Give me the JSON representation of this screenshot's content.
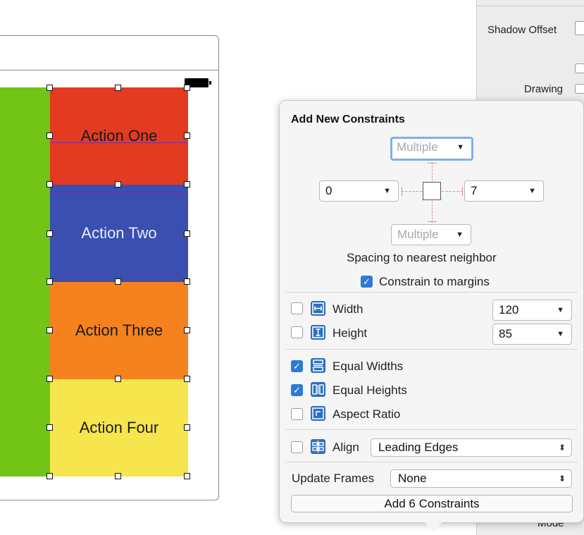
{
  "inspector": {
    "shadow_offset_label": "Shadow Offset",
    "drawing_label": "Drawing",
    "mode_label": "Mode"
  },
  "canvas": {
    "actions": [
      {
        "label": "Action One",
        "color": "#e23b22",
        "text_color": "#1a1a1a"
      },
      {
        "label": "Action Two",
        "color": "#3a4fb0",
        "text_color": "#e8ecff"
      },
      {
        "label": "Action Three",
        "color": "#f5821f",
        "text_color": "#1a1a1a"
      },
      {
        "label": "Action Four",
        "color": "#f6e54c",
        "text_color": "#1a1a1a"
      }
    ],
    "side_color": "#72c416"
  },
  "popover": {
    "title": "Add New Constraints",
    "top_value": "Multiple",
    "bottom_value": "Multiple",
    "leading_value": "0",
    "trailing_value": "7",
    "spacing_caption": "Spacing to nearest neighbor",
    "constrain_to_margins": {
      "label": "Constrain to margins",
      "checked": true
    },
    "width": {
      "label": "Width",
      "value": "120",
      "checked": false,
      "icon": "width-icon"
    },
    "height": {
      "label": "Height",
      "value": "85",
      "checked": false,
      "icon": "height-icon"
    },
    "equal_widths": {
      "label": "Equal Widths",
      "checked": true,
      "icon": "equal-widths-icon"
    },
    "equal_heights": {
      "label": "Equal Heights",
      "checked": true,
      "icon": "equal-heights-icon"
    },
    "aspect_ratio": {
      "label": "Aspect Ratio",
      "checked": false,
      "icon": "aspect-ratio-icon"
    },
    "align": {
      "label": "Align",
      "value": "Leading Edges",
      "checked": false,
      "icon": "align-icon"
    },
    "update_frames": {
      "label": "Update Frames",
      "value": "None"
    },
    "add_button": "Add 6 Constraints",
    "accent": "#2e7bd6"
  }
}
